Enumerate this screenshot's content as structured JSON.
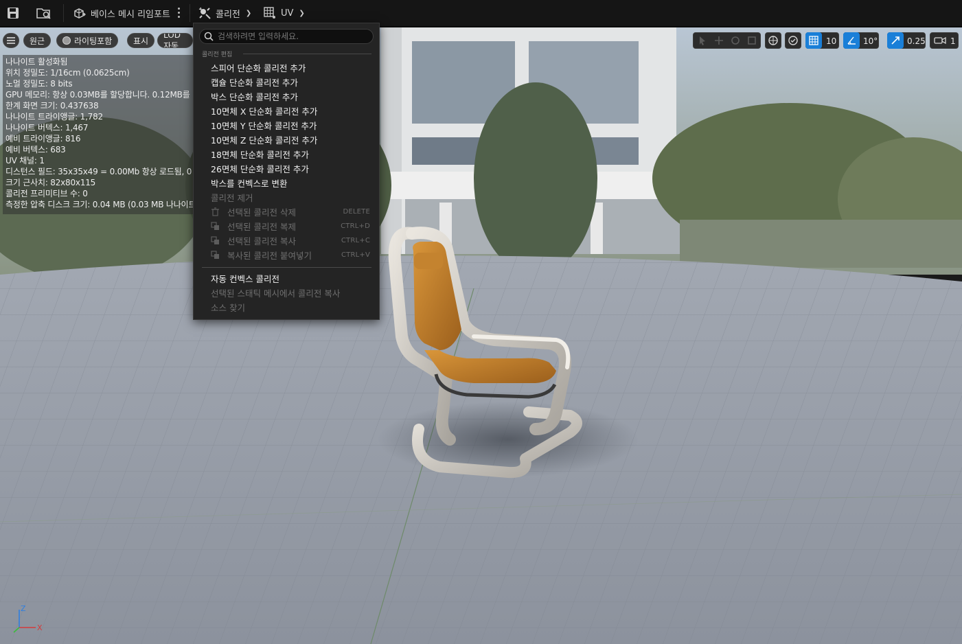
{
  "toolbar": {
    "reimport_label": "베이스 메시 리임포트",
    "collision_label": "콜리전",
    "uv_label": "UV"
  },
  "viewport_buttons": {
    "perspective": "원근",
    "lighting": "라이팅포함",
    "show": "표시",
    "lod": "LOD 자동"
  },
  "stats": [
    "나나이트 활성화됨",
    "위치 정밀도: 1/16cm (0.0625cm)",
    "노멀 정밀도: 8 bits",
    "GPU 메모리: 항상 0.03MB를 할당합니다. 0.12MB를",
    "한계 화면 크기: 0.437638",
    "나나이트 트라이앵글: 1,782",
    "나나이트 버텍스: 1,467",
    "예비 트라이앵글: 816",
    "예비 버텍스: 683",
    "UV 채널: 1",
    "디스턴스 필드: 35x35x49 = 0.00Mb 항상 로드됨, 0",
    "크기 근사치: 82x80x115",
    "콜리전 프리미티브 수: 0",
    "측정한 압축 디스크 크기: 0.04 MB (0.03 MB 나나이트"
  ],
  "right_toolbar": {
    "grid_snap": "10",
    "rotation_snap": "10°",
    "scale_snap": "0.25",
    "camera_speed": "1"
  },
  "axis": {
    "z": "Z",
    "x": "X"
  },
  "menu": {
    "search_placeholder": "검색하려면 입력하세요.",
    "section_title": "콜리전 편집",
    "items": [
      {
        "label": "스피어 단순화 콜리전 추가"
      },
      {
        "label": "캡슐 단순화 콜리전 추가"
      },
      {
        "label": "박스 단순화 콜리전 추가"
      },
      {
        "label": "10면체 X 단순화 콜리전 추가"
      },
      {
        "label": "10면체 Y 단순화 콜리전 추가"
      },
      {
        "label": "10면체 Z 단순화 콜리전 추가"
      },
      {
        "label": "18면체 단순화 콜리전 추가"
      },
      {
        "label": "26면체 단순화 콜리전 추가"
      },
      {
        "label": "박스를 컨벡스로 변환"
      },
      {
        "label": "콜리전 제거"
      },
      {
        "label": "선택된 콜리전 삭제",
        "shortcut": "DELETE"
      },
      {
        "label": "선택된 콜리전 복제",
        "shortcut": "CTRL+D"
      },
      {
        "label": "선택된 콜리전 복사",
        "shortcut": "CTRL+C"
      },
      {
        "label": "복사된 콜리전 붙여넣기",
        "shortcut": "CTRL+V"
      },
      {
        "label": "자동 컨벡스 콜리전"
      },
      {
        "label": "선택된 스태틱 메시에서 콜리전 복사"
      },
      {
        "label": "소스 찾기"
      }
    ]
  },
  "colors": {
    "accent_blue": "#1a7fd8",
    "menu_bg": "#242424",
    "toolbar_bg": "#151515",
    "seat_orange": "#c98a2e"
  }
}
